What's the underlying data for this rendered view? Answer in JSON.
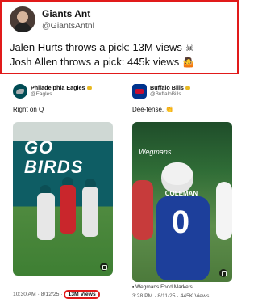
{
  "tweet": {
    "display_name": "Giants Ant",
    "handle": "@GiantsAntnl",
    "lines": [
      "Jalen Hurts throws a pick: 13M views",
      "Josh Allen throws a pick: 445k views"
    ],
    "emoji": [
      "skull-crossbones-emoji",
      "shrug-emoji"
    ]
  },
  "left_card": {
    "account": "Philadelphia Eagles",
    "handle": "@Eagles",
    "caption": "Right on Q",
    "banner_text": "GO BIRDS",
    "time": "10:30 AM · 8/12/25 · ",
    "views": "13M Views"
  },
  "right_card": {
    "account": "Buffalo Bills",
    "handle": "@BuffaloBills",
    "caption": "Dee-fense.",
    "sponsor": "Wegmans Food Markets",
    "wordmark": "Wegmans",
    "player_name": "COLEMAN",
    "player_number": "0",
    "time": "3:28 PM · 8/11/25 · ",
    "views": "445K Views"
  },
  "colors": {
    "highlight": "#e11a1a",
    "eagles": "#004c54",
    "bills": "#00338d"
  }
}
